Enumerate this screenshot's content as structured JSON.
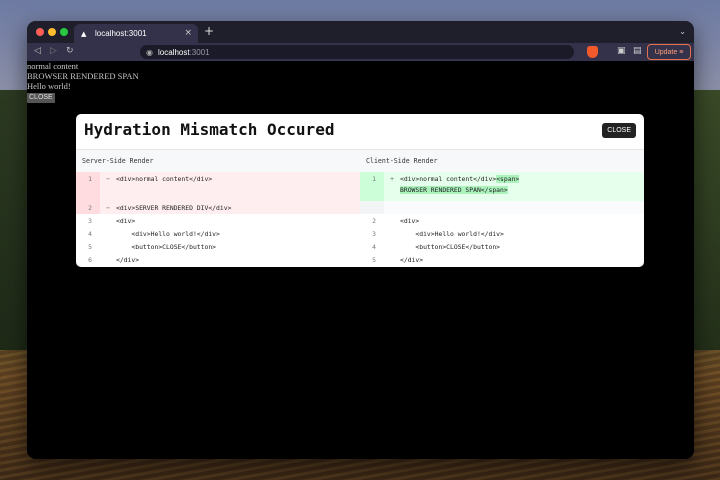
{
  "browser": {
    "tab_title": "localhost:3001",
    "tab_close": "×",
    "new_tab": "+",
    "tab_menu": "⌄",
    "url_host": "localhost",
    "url_port": ":3001",
    "update_label": "Update ≡"
  },
  "page": {
    "lines": [
      "normal content",
      "BROWSER RENDERED SPAN",
      "Hello world!"
    ],
    "close_button": "CLOSE"
  },
  "modal": {
    "title": "Hydration Mismatch Occured",
    "close_label": "CLOSE",
    "server": {
      "label": "Server-Side Render",
      "rows": [
        {
          "num": "1",
          "mark": "−",
          "code": "<div>normal content</div>"
        },
        {
          "num": "2",
          "mark": "−",
          "code": "<div>SERVER RENDERED DIV</div>"
        },
        {
          "num": "3",
          "mark": "",
          "code": "<div>"
        },
        {
          "num": "4",
          "mark": "",
          "code": "    <div>Hello world!</div>"
        },
        {
          "num": "5",
          "mark": "",
          "code": "    <button>CLOSE</button>"
        },
        {
          "num": "6",
          "mark": "",
          "code": "</div>"
        }
      ]
    },
    "client": {
      "label": "Client-Side Render",
      "rows": [
        {
          "num": "1",
          "mark": "+",
          "code_a": "<div>normal content</div>",
          "code_b": "<span>",
          "code_c": "BROWSER RENDERED SPAN</span>"
        },
        {
          "num": "2",
          "mark": "",
          "code": "<div>"
        },
        {
          "num": "3",
          "mark": "",
          "code": "    <div>Hello world!</div>"
        },
        {
          "num": "4",
          "mark": "",
          "code": "    <button>CLOSE</button>"
        },
        {
          "num": "5",
          "mark": "",
          "code": "</div>"
        }
      ]
    }
  }
}
